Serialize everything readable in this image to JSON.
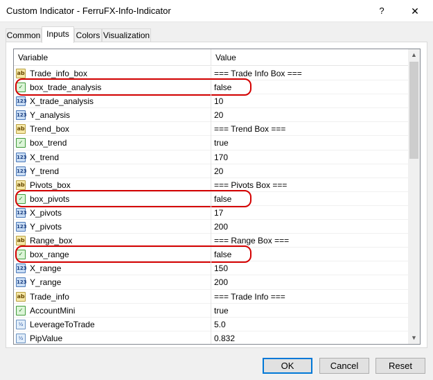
{
  "window": {
    "title": "Custom Indicator - FerruFX-Info-Indicator",
    "help_glyph": "?",
    "close_glyph": "✕"
  },
  "tabs": [
    {
      "label": "Common"
    },
    {
      "label": "Inputs",
      "active": true
    },
    {
      "label": "Colors"
    },
    {
      "label": "Visualization"
    }
  ],
  "grid": {
    "headers": {
      "variable": "Variable",
      "value": "Value"
    },
    "rows": [
      {
        "icon": "ab-icon",
        "glyph": "ab",
        "variable": "Trade_info_box",
        "value": "=== Trade Info Box ==="
      },
      {
        "icon": "bool-icon",
        "glyph": "✓",
        "variable": "box_trade_analysis",
        "value": "false",
        "highlight": true
      },
      {
        "icon": "num-icon",
        "glyph": "123",
        "variable": "X_trade_analysis",
        "value": "10"
      },
      {
        "icon": "num-icon",
        "glyph": "123",
        "variable": "Y_analysis",
        "value": "20"
      },
      {
        "icon": "ab-icon",
        "glyph": "ab",
        "variable": "Trend_box",
        "value": "=== Trend Box ==="
      },
      {
        "icon": "bool-icon",
        "glyph": "✓",
        "variable": "box_trend",
        "value": "true"
      },
      {
        "icon": "num-icon",
        "glyph": "123",
        "variable": "X_trend",
        "value": "170"
      },
      {
        "icon": "num-icon",
        "glyph": "123",
        "variable": "Y_trend",
        "value": "20"
      },
      {
        "icon": "ab-icon",
        "glyph": "ab",
        "variable": "Pivots_box",
        "value": "=== Pivots Box ==="
      },
      {
        "icon": "bool-icon",
        "glyph": "✓",
        "variable": "box_pivots",
        "value": "false",
        "highlight": true
      },
      {
        "icon": "num-icon",
        "glyph": "123",
        "variable": "X_pivots",
        "value": "17"
      },
      {
        "icon": "num-icon",
        "glyph": "123",
        "variable": "Y_pivots",
        "value": "200"
      },
      {
        "icon": "ab-icon",
        "glyph": "ab",
        "variable": "Range_box",
        "value": "=== Range Box ==="
      },
      {
        "icon": "bool-icon",
        "glyph": "✓",
        "variable": "box_range",
        "value": "false",
        "highlight": true
      },
      {
        "icon": "num-icon",
        "glyph": "123",
        "variable": "X_range",
        "value": "150"
      },
      {
        "icon": "num-icon",
        "glyph": "123",
        "variable": "Y_range",
        "value": "200"
      },
      {
        "icon": "ab-icon",
        "glyph": "ab",
        "variable": "Trade_info",
        "value": "=== Trade Info ==="
      },
      {
        "icon": "bool-icon",
        "glyph": "✓",
        "variable": "AccountMini",
        "value": "true"
      },
      {
        "icon": "double-icon",
        "glyph": "½",
        "variable": "LeverageToTrade",
        "value": "5.0"
      },
      {
        "icon": "double-icon",
        "glyph": "½",
        "variable": "PipValue",
        "value": "0.832"
      }
    ],
    "highlight_color": "#d40000"
  },
  "buttons": {
    "ok": "OK",
    "cancel": "Cancel",
    "reset": "Reset"
  },
  "colors": {
    "accent": "#0078d7",
    "window_bg": "#f0f0f0"
  }
}
